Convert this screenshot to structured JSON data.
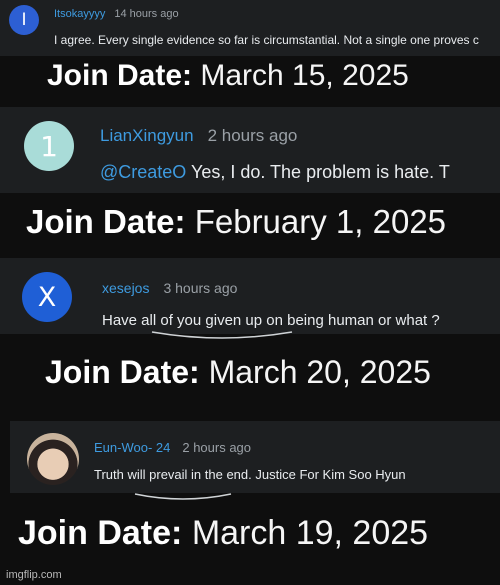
{
  "panels": [
    {
      "avatar_letter": "I",
      "avatar_color": "#2d5fd3",
      "username": "Itsokayyyy",
      "time": "14 hours ago",
      "mention": "",
      "text": "I agree. Every single evidence so far is circumstantial. Not a single one proves c",
      "join_label": "Join Date:",
      "join_date": "March 15, 2025"
    },
    {
      "avatar_letter": "1",
      "avatar_color": "#a9dcd8",
      "username": "LianXingyun",
      "time": "2 hours ago",
      "mention": "@CreateO",
      "text": " Yes, I do. The problem is hate. T",
      "join_label": "Join Date:",
      "join_date": "February 1, 2025"
    },
    {
      "avatar_letter": "X",
      "avatar_color": "#1f5fd6",
      "username": "xesejos",
      "time": "3 hours ago",
      "mention": "",
      "text": "Have all of you given up on being human or what ?",
      "join_label": "Join Date:",
      "join_date": "March 20, 2025"
    },
    {
      "avatar_letter": "",
      "avatar_color": "#c8b39c",
      "username": "Eun-Woo- 24",
      "time": "2 hours ago",
      "mention": "",
      "text": "Truth will prevail in the end. Justice For Kim Soo Hyun",
      "join_label": "Join Date:",
      "join_date": "March 19, 2025"
    }
  ],
  "watermark": "imgflip.com"
}
